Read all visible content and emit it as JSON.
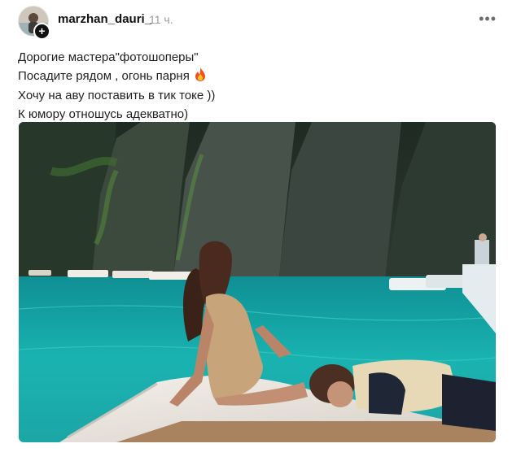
{
  "post": {
    "username": "marzhan_dauri_",
    "time": "11 ч.",
    "more_icon": "more-horizontal-icon",
    "avatar_badge_icon": "plus-icon",
    "lines": [
      "Дорогие мастера\"фотошоперы\"",
      "Посадите рядом , огонь парня",
      "Хочу на аву поставить в тик токе ))",
      "К юмору отношусь адекватно)"
    ],
    "emoji_icon": "fire-emoji-icon"
  },
  "colors": {
    "water": "#19b3b0",
    "cliff": "#2c3a2e",
    "boat_deck": "#e8e3dc",
    "username": "#111111",
    "timestamp": "#9a9a9a"
  }
}
